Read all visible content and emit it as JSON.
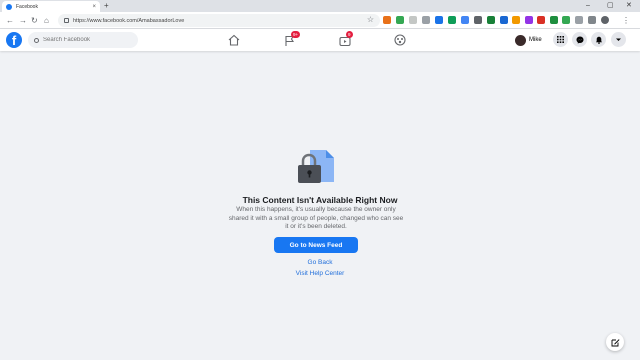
{
  "browser": {
    "tab_title": "Facebook",
    "tab_close": "×",
    "new_tab": "+",
    "url": "https://www.facebook.com/AmabassadorLove",
    "window_controls": [
      "–",
      "▢",
      "✕"
    ]
  },
  "header": {
    "logo": "f",
    "search_placeholder": "Search Facebook",
    "pages_badge": "9+",
    "watch_badge": "9",
    "profile_name": "Mike"
  },
  "content": {
    "title": "This Content Isn't Available Right Now",
    "description": "When this happens, it's usually because the owner only shared it with a small group of people, changed who can see it or it's been deleted.",
    "primary_button": "Go to News Feed",
    "back_link": "Go Back",
    "help_link": "Visit Help Center"
  },
  "colors": {
    "brand": "#1877f2",
    "badge": "#e41e3f",
    "background": "#f0f2f5"
  },
  "icons": [
    "home-icon",
    "flag-icon",
    "watch-icon",
    "groups-icon",
    "menu-grid-icon",
    "messenger-icon",
    "bell-icon",
    "caret-down-icon",
    "compose-icon",
    "lock-document-icon"
  ]
}
